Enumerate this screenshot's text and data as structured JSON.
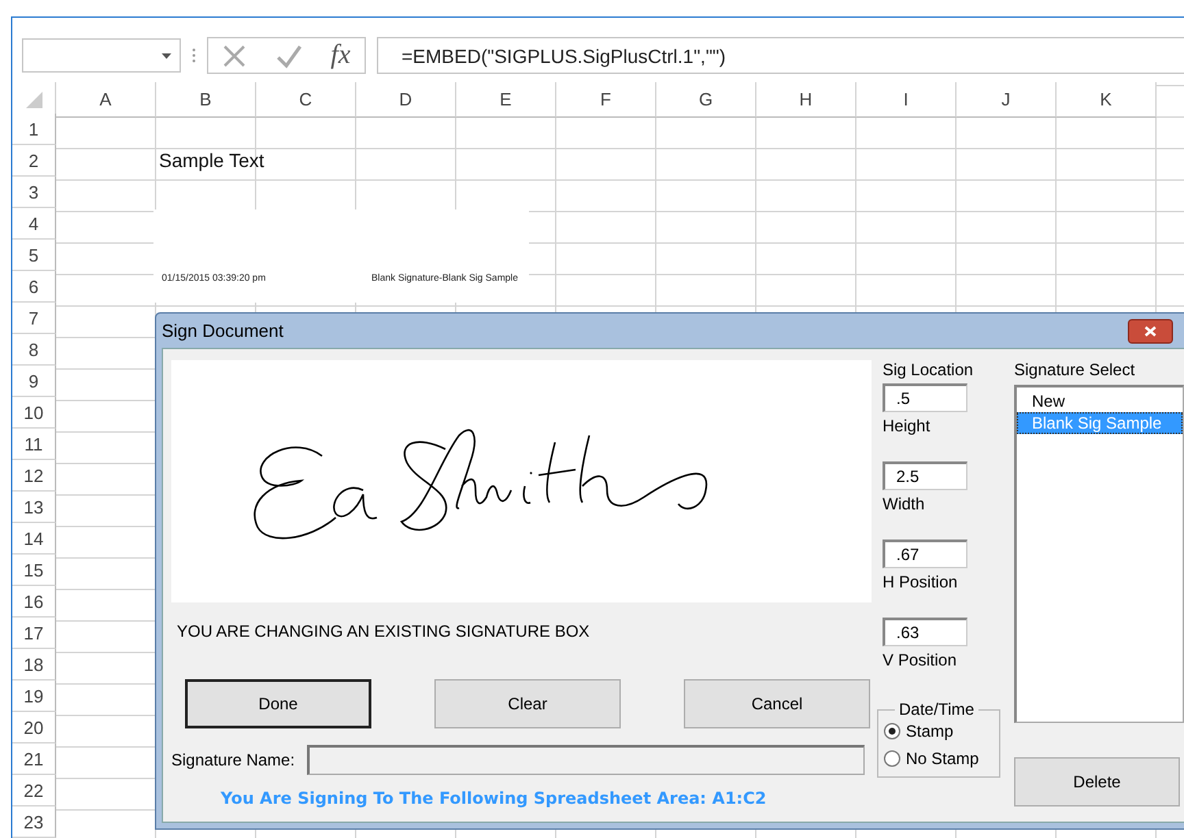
{
  "formula_bar": {
    "function_label": "fx",
    "formula": "=EMBED(\"SIGPLUS.SigPlusCtrl.1\",\"\")"
  },
  "sheet": {
    "columns": [
      "A",
      "B",
      "C",
      "D",
      "E",
      "F",
      "G",
      "H",
      "I",
      "J",
      "K"
    ],
    "rows": [
      "1",
      "2",
      "3",
      "4",
      "5",
      "6",
      "7",
      "8",
      "9",
      "10",
      "11",
      "12",
      "13",
      "14",
      "15",
      "16",
      "17",
      "18",
      "19",
      "20",
      "21",
      "22",
      "23"
    ],
    "cell_b2": "Sample Text"
  },
  "embedded_signature": {
    "date": "01/15/2015 03:39:20 pm",
    "caption": "Blank Signature-Blank Sig Sample"
  },
  "dialog": {
    "title": "Sign Document",
    "message": "YOU ARE CHANGING AN EXISTING SIGNATURE BOX",
    "buttons": [
      {
        "label": "Done",
        "default": true
      },
      {
        "label": "Clear",
        "default": false
      },
      {
        "label": "Cancel",
        "default": false
      }
    ],
    "name_label": "Signature Name:",
    "area_note": "You Are Signing To The Following Spreadsheet Area: A1:C2",
    "sig_location": {
      "label": "Sig Location",
      "fields": [
        {
          "value": ".5",
          "label": "Height"
        },
        {
          "value": "2.5",
          "label": "Width"
        },
        {
          "value": ".67",
          "label": "H Position"
        },
        {
          "value": ".63",
          "label": "V Position"
        }
      ]
    },
    "date_time": {
      "label": "Date/Time",
      "options": [
        {
          "label": "Stamp",
          "selected": true
        },
        {
          "label": "No Stamp",
          "selected": false
        }
      ]
    },
    "signature_select": {
      "label": "Signature Select",
      "items": [
        {
          "label": "New",
          "selected": false
        },
        {
          "label": "Blank Sig Sample",
          "selected": true
        }
      ]
    },
    "delete_button": "Delete"
  }
}
